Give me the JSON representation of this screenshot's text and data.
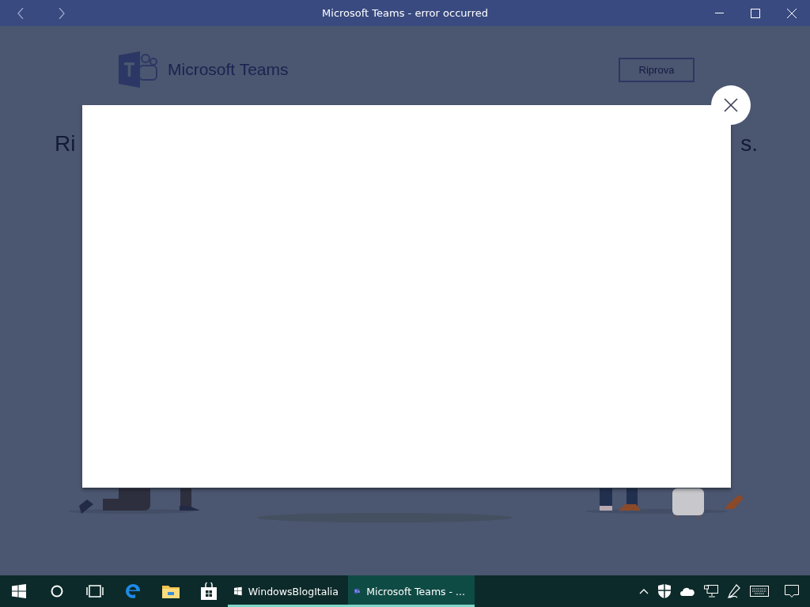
{
  "window": {
    "title": "Microsoft Teams - error occurred"
  },
  "background": {
    "logo_text": "Microsoft Teams",
    "retry_button": "Riprova",
    "heading_start": "Ri",
    "heading_end": "s."
  },
  "taskbar": {
    "apps": [
      {
        "kind": "windows",
        "label": "WindowsBlogItalia",
        "selected": false
      },
      {
        "kind": "teams",
        "label": "Microsoft Teams - ...",
        "selected": true
      }
    ]
  }
}
